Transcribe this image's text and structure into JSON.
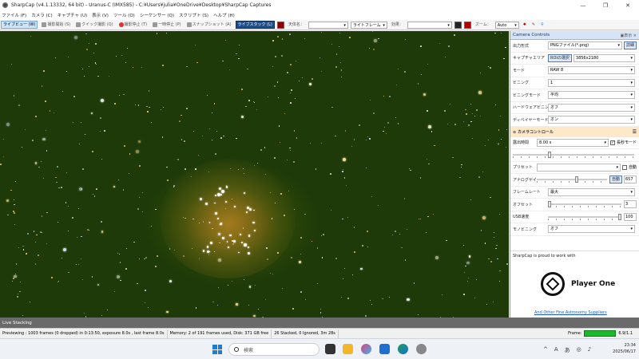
{
  "window": {
    "title": "SharpCap (v4.1.13332, 64 bit) - Uranus-C (IMX585) - C:¥Users¥julia¥OneDrive¥Desktop¥SharpCap Captures",
    "minimize": "—",
    "maximize": "❐",
    "close": "✕"
  },
  "menu": [
    "ファイル (F)",
    "カメラ (C)",
    "キャプチャ (U)",
    "表示 (V)",
    "ツール (O)",
    "シーケンサー (Q)",
    "スクリプト (S)",
    "ヘルプ (H)"
  ],
  "toolbar": {
    "live_view": "ライブビュー (W)",
    "start_capture": "撮影開始 (S)",
    "quick_capture": "クイック撮影 (Q)",
    "stop_capture": "撮影停止 (T)",
    "pause": "一時停止 (P)",
    "snapshot": "スナップショット (A)",
    "live_stack": "ライブスタック (L)",
    "target_name_label": "天体名：",
    "target_name_value": "",
    "frame_type": "ライトフレーム",
    "effect_label": "効果：",
    "effect_value": "",
    "zoom_label": "ズーム：",
    "zoom_value": "Auto"
  },
  "panel": {
    "title": "Camera Controls",
    "header_right": "▣表示 ✕",
    "rows": [
      {
        "label": "出力形式",
        "value": "PNGファイル(*.png)",
        "extra": "詳細"
      },
      {
        "label": "キャプチャエリア",
        "value": "3856x2180",
        "extra": "ROIの選択"
      },
      {
        "label": "モード",
        "value": "RAW 8"
      },
      {
        "label": "ビニング",
        "value": "1"
      },
      {
        "label": "ビニングモード",
        "value": "平均"
      },
      {
        "label": "ハードウェアビニング",
        "value": "オフ"
      },
      {
        "label": "ディベイヤーモード",
        "value": "オン"
      }
    ],
    "section_title": "カメラコントロール",
    "exposure_label": "露出時間",
    "exposure_value": "8.00 s",
    "long_exposure_label": "長秒モード",
    "preset_label": "プリセット",
    "auto_label": "自動",
    "gain_label": "アナログゲイン",
    "gain_auto": "自動",
    "gain_value": "657",
    "framerate_label": "フレームレート",
    "framerate_value": "最大",
    "offset_label": "オフセット",
    "offset_value": "3",
    "usb_label": "USB速度",
    "usb_value": "100",
    "monobin_label": "モノビニング",
    "monobin_value": "オフ",
    "promo_text": "SharpCap is proud to work with",
    "promo_brand": "Player One",
    "promo_link": "And Other Fine Astronomy Suppliers"
  },
  "livebar": "Live Stacking",
  "status": {
    "previewing": "Previewing : 1003 frames (0 dropped) in 0:13:50, exposure 8.0s , last frame 8.0s",
    "memory": "Memory: 2 of 191 frames used, Disk: 371 GB free",
    "stacked": "26 Stacked, 0 Ignored, 3m 28s",
    "frame_label": "Frame:",
    "frame_value": "6.9/1.1",
    "frame_progress": 1.0
  },
  "taskbar": {
    "search_placeholder": "検索",
    "time": "23:34",
    "date": "2025/06/17",
    "ime": "あ",
    "lang": "A"
  },
  "colors": {
    "accent": "#1a7fd4",
    "frame_bar": "#1eb82b",
    "section_bg": "#fde8c8"
  }
}
